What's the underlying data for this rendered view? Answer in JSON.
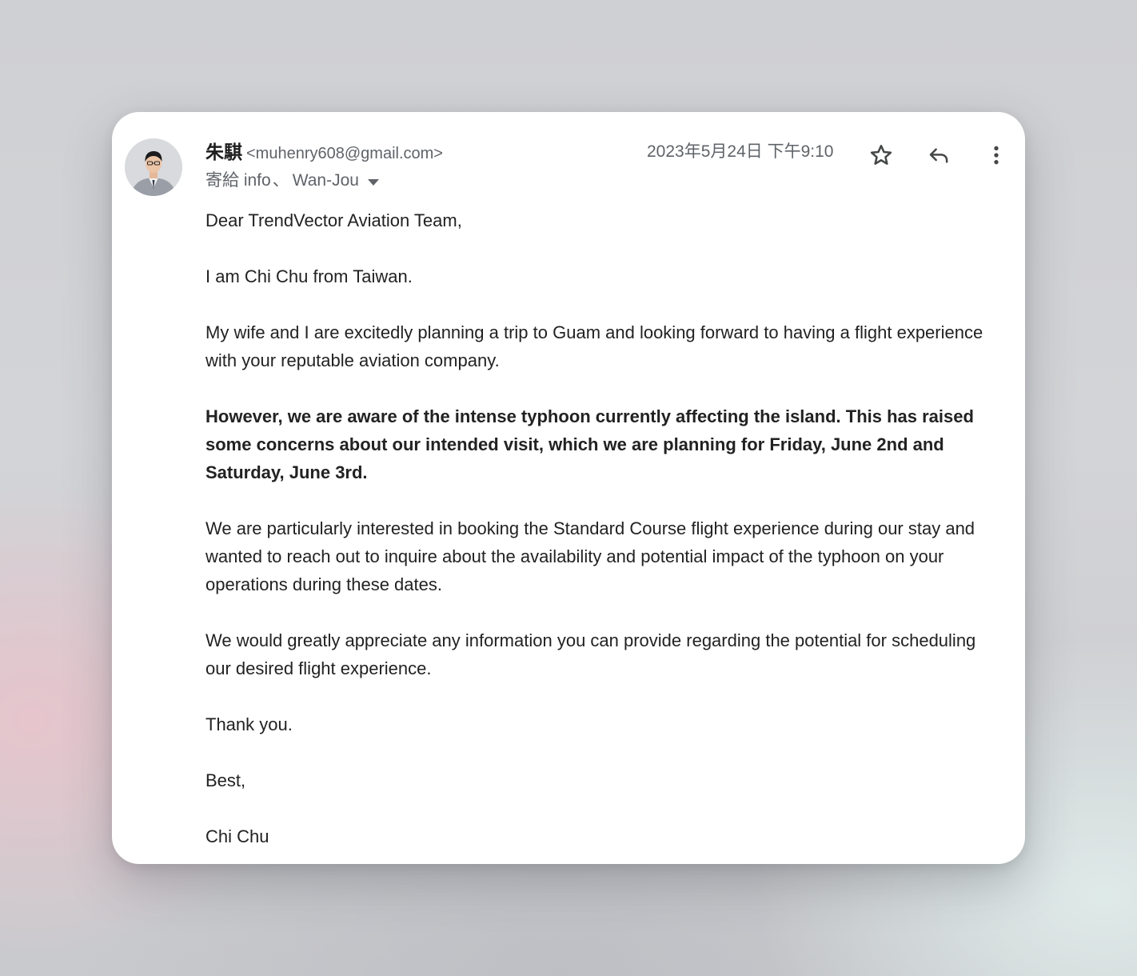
{
  "email": {
    "sender": {
      "name": "朱騏",
      "email": "<muhenry608@gmail.com>"
    },
    "recipients": {
      "prefix": "寄給 info",
      "separator": "、",
      "second": "Wan-Jou"
    },
    "date": "2023年5月24日 下午9:10",
    "actions": {
      "star_icon": "star-outline-icon",
      "reply_icon": "reply-icon",
      "more_icon": "more-vertical-icon"
    },
    "body": {
      "greeting": "Dear TrendVector Aviation Team,",
      "intro": "I am Chi Chu from Taiwan.",
      "para1": "My wife and I are excitedly planning a trip to Guam and looking forward to having a flight experience with your reputable aviation company.",
      "para2_bold": "However, we are aware of the intense typhoon currently affecting the island. This has raised some concerns about our intended visit, which we are planning for Friday, June 2nd and Saturday, June 3rd.",
      "para3": "We are particularly interested in booking the Standard Course flight experience during our stay and wanted to reach out to inquire about the availability and potential impact of the typhoon on your operations during these dates.",
      "para4": "We would greatly appreciate any information you can provide regarding the potential for scheduling our desired flight experience.",
      "thanks": "Thank you.",
      "closing": "Best,",
      "signature": "Chi Chu"
    }
  }
}
